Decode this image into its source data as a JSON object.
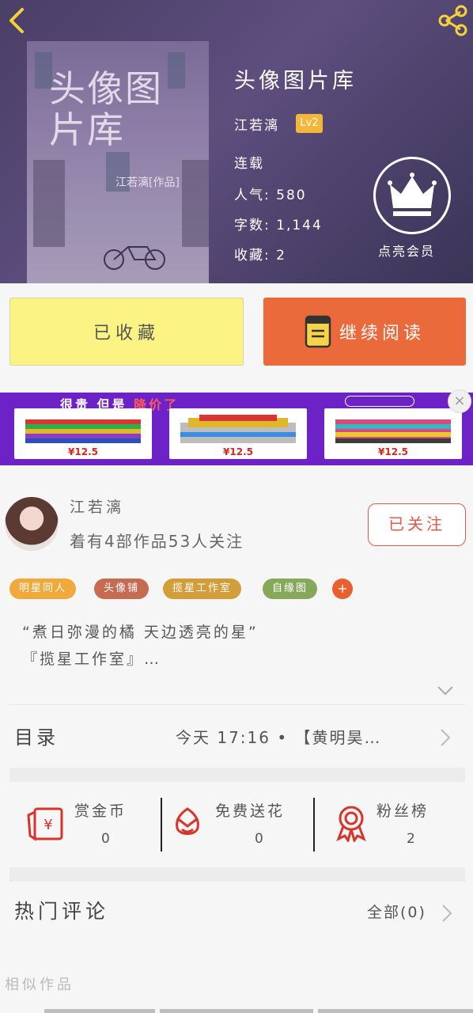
{
  "book": {
    "title": "头像图片库",
    "cover_title": "头像图片库",
    "cover_author": "江若漓[作品]",
    "author_name": "江若漓",
    "level": "Lv2",
    "status": "连载",
    "popularity_label": "人气:",
    "popularity": "580",
    "word_count_label": "字数:",
    "word_count": "1,144",
    "favorites_label": "收藏:",
    "favorites": "2"
  },
  "vip": {
    "label": "点亮会员"
  },
  "actions": {
    "collected_label": "已收藏",
    "continue_label": "继续阅读"
  },
  "ad": {
    "headline_a": "很贵 但是",
    "headline_b": "降价了",
    "prices": [
      "¥12.5",
      "¥12.5",
      "¥12.5"
    ]
  },
  "author": {
    "name": "江若漓",
    "stats": "着有4部作品53人关注",
    "follow_label": "已关注"
  },
  "tags": [
    {
      "label": "明星同人",
      "color": "#f2a93b"
    },
    {
      "label": "头像铺",
      "color": "#c76a52"
    },
    {
      "label": "揽星工作室",
      "color": "#d39d3a"
    },
    {
      "label": "自缘图",
      "color": "#86a85a"
    }
  ],
  "tag_more": "+",
  "description": {
    "line1": "“煮日弥漫的橘 天边透亮的星”",
    "line2": "『揽星工作室』…"
  },
  "toc": {
    "label": "目录",
    "latest": "今天 17:16 • 【黄明昊…"
  },
  "stats": {
    "coins_label": "赏金币",
    "coins": "0",
    "flowers_label": "免费送花",
    "flowers": "0",
    "fans_label": "粉丝榜",
    "fans": "2"
  },
  "comments": {
    "label": "热门评论",
    "all_label": "全部(0)"
  },
  "similar_label": "相似作品",
  "colors": {
    "accent_orange": "#ea6a3b",
    "collected_yellow": "#fbf384",
    "icon_red": "#d8342a"
  }
}
